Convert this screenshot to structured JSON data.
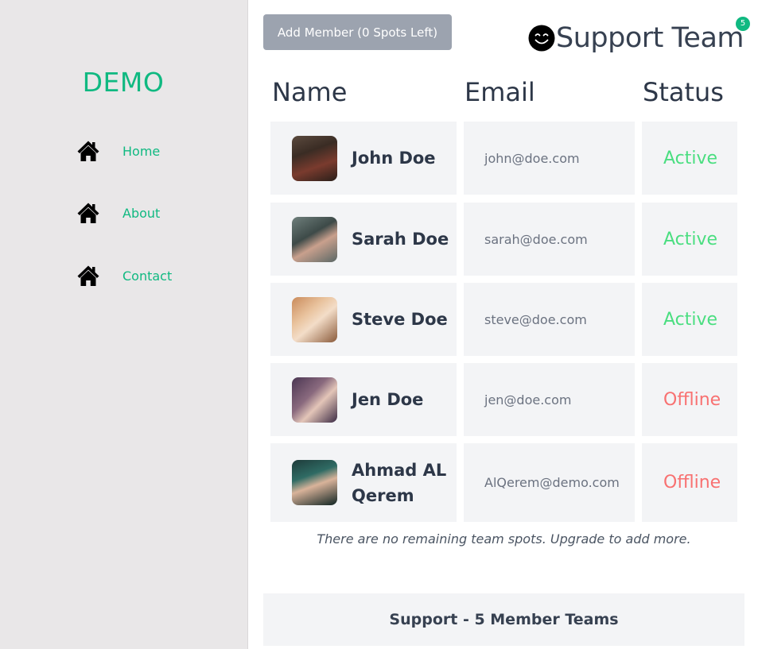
{
  "sidebar": {
    "logo": "DEMO",
    "nav": [
      {
        "label": "Home",
        "icon": "home-icon"
      },
      {
        "label": "About",
        "icon": "home-icon"
      },
      {
        "label": "Contact",
        "icon": "home-icon"
      }
    ]
  },
  "header": {
    "add_button": "Add Member (0 Spots Left)",
    "team_icon": "smiley-icon",
    "team_name": "Support Team",
    "member_count": "5"
  },
  "table": {
    "headers": {
      "name": "Name",
      "email": "Email",
      "status": "Status"
    },
    "rows": [
      {
        "name": "John Doe",
        "email": "john@doe.com",
        "status": "Active"
      },
      {
        "name": "Sarah Doe",
        "email": "sarah@doe.com",
        "status": "Active"
      },
      {
        "name": "Steve Doe",
        "email": "steve@doe.com",
        "status": "Active"
      },
      {
        "name": "Jen Doe",
        "email": "jen@doe.com",
        "status": "Offline"
      },
      {
        "name": "Ahmad AL Qerem",
        "email": "AlQerem@demo.com",
        "status": "Offline"
      }
    ]
  },
  "notice": "There are no remaining team spots. Upgrade to add more.",
  "plan": "Support - 5 Member Teams",
  "colors": {
    "accent": "#10b981",
    "active": "#4ade80",
    "offline": "#f87171",
    "button": "#9ca3af",
    "sidebar": "#e9e7e8",
    "cell": "#f3f4f6"
  }
}
